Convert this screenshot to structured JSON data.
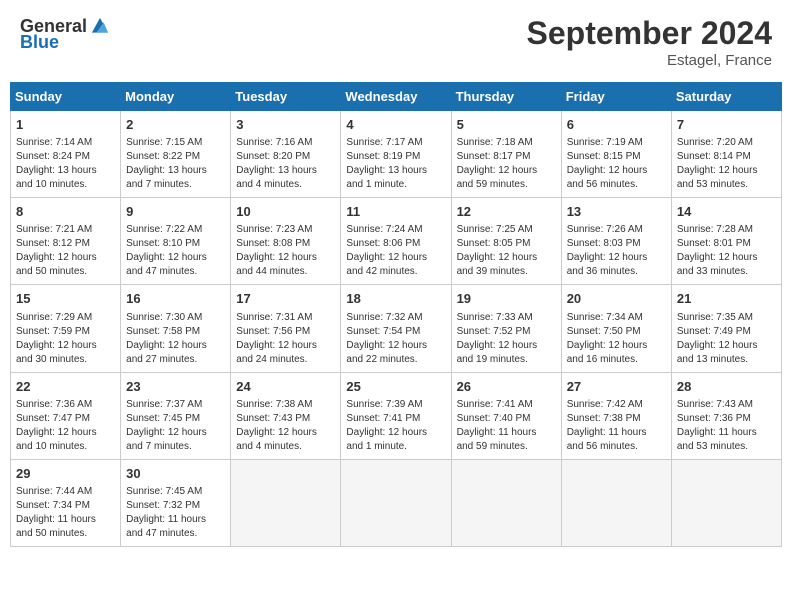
{
  "header": {
    "logo_general": "General",
    "logo_blue": "Blue",
    "title": "September 2024",
    "location": "Estagel, France"
  },
  "calendar": {
    "days_of_week": [
      "Sunday",
      "Monday",
      "Tuesday",
      "Wednesday",
      "Thursday",
      "Friday",
      "Saturday"
    ],
    "weeks": [
      [
        {
          "day": "1",
          "detail": "Sunrise: 7:14 AM\nSunset: 8:24 PM\nDaylight: 13 hours and 10 minutes."
        },
        {
          "day": "2",
          "detail": "Sunrise: 7:15 AM\nSunset: 8:22 PM\nDaylight: 13 hours and 7 minutes."
        },
        {
          "day": "3",
          "detail": "Sunrise: 7:16 AM\nSunset: 8:20 PM\nDaylight: 13 hours and 4 minutes."
        },
        {
          "day": "4",
          "detail": "Sunrise: 7:17 AM\nSunset: 8:19 PM\nDaylight: 13 hours and 1 minute."
        },
        {
          "day": "5",
          "detail": "Sunrise: 7:18 AM\nSunset: 8:17 PM\nDaylight: 12 hours and 59 minutes."
        },
        {
          "day": "6",
          "detail": "Sunrise: 7:19 AM\nSunset: 8:15 PM\nDaylight: 12 hours and 56 minutes."
        },
        {
          "day": "7",
          "detail": "Sunrise: 7:20 AM\nSunset: 8:14 PM\nDaylight: 12 hours and 53 minutes."
        }
      ],
      [
        {
          "day": "8",
          "detail": "Sunrise: 7:21 AM\nSunset: 8:12 PM\nDaylight: 12 hours and 50 minutes."
        },
        {
          "day": "9",
          "detail": "Sunrise: 7:22 AM\nSunset: 8:10 PM\nDaylight: 12 hours and 47 minutes."
        },
        {
          "day": "10",
          "detail": "Sunrise: 7:23 AM\nSunset: 8:08 PM\nDaylight: 12 hours and 44 minutes."
        },
        {
          "day": "11",
          "detail": "Sunrise: 7:24 AM\nSunset: 8:06 PM\nDaylight: 12 hours and 42 minutes."
        },
        {
          "day": "12",
          "detail": "Sunrise: 7:25 AM\nSunset: 8:05 PM\nDaylight: 12 hours and 39 minutes."
        },
        {
          "day": "13",
          "detail": "Sunrise: 7:26 AM\nSunset: 8:03 PM\nDaylight: 12 hours and 36 minutes."
        },
        {
          "day": "14",
          "detail": "Sunrise: 7:28 AM\nSunset: 8:01 PM\nDaylight: 12 hours and 33 minutes."
        }
      ],
      [
        {
          "day": "15",
          "detail": "Sunrise: 7:29 AM\nSunset: 7:59 PM\nDaylight: 12 hours and 30 minutes."
        },
        {
          "day": "16",
          "detail": "Sunrise: 7:30 AM\nSunset: 7:58 PM\nDaylight: 12 hours and 27 minutes."
        },
        {
          "day": "17",
          "detail": "Sunrise: 7:31 AM\nSunset: 7:56 PM\nDaylight: 12 hours and 24 minutes."
        },
        {
          "day": "18",
          "detail": "Sunrise: 7:32 AM\nSunset: 7:54 PM\nDaylight: 12 hours and 22 minutes."
        },
        {
          "day": "19",
          "detail": "Sunrise: 7:33 AM\nSunset: 7:52 PM\nDaylight: 12 hours and 19 minutes."
        },
        {
          "day": "20",
          "detail": "Sunrise: 7:34 AM\nSunset: 7:50 PM\nDaylight: 12 hours and 16 minutes."
        },
        {
          "day": "21",
          "detail": "Sunrise: 7:35 AM\nSunset: 7:49 PM\nDaylight: 12 hours and 13 minutes."
        }
      ],
      [
        {
          "day": "22",
          "detail": "Sunrise: 7:36 AM\nSunset: 7:47 PM\nDaylight: 12 hours and 10 minutes."
        },
        {
          "day": "23",
          "detail": "Sunrise: 7:37 AM\nSunset: 7:45 PM\nDaylight: 12 hours and 7 minutes."
        },
        {
          "day": "24",
          "detail": "Sunrise: 7:38 AM\nSunset: 7:43 PM\nDaylight: 12 hours and 4 minutes."
        },
        {
          "day": "25",
          "detail": "Sunrise: 7:39 AM\nSunset: 7:41 PM\nDaylight: 12 hours and 1 minute."
        },
        {
          "day": "26",
          "detail": "Sunrise: 7:41 AM\nSunset: 7:40 PM\nDaylight: 11 hours and 59 minutes."
        },
        {
          "day": "27",
          "detail": "Sunrise: 7:42 AM\nSunset: 7:38 PM\nDaylight: 11 hours and 56 minutes."
        },
        {
          "day": "28",
          "detail": "Sunrise: 7:43 AM\nSunset: 7:36 PM\nDaylight: 11 hours and 53 minutes."
        }
      ],
      [
        {
          "day": "29",
          "detail": "Sunrise: 7:44 AM\nSunset: 7:34 PM\nDaylight: 11 hours and 50 minutes."
        },
        {
          "day": "30",
          "detail": "Sunrise: 7:45 AM\nSunset: 7:32 PM\nDaylight: 11 hours and 47 minutes."
        },
        {
          "day": "",
          "detail": ""
        },
        {
          "day": "",
          "detail": ""
        },
        {
          "day": "",
          "detail": ""
        },
        {
          "day": "",
          "detail": ""
        },
        {
          "day": "",
          "detail": ""
        }
      ]
    ]
  }
}
